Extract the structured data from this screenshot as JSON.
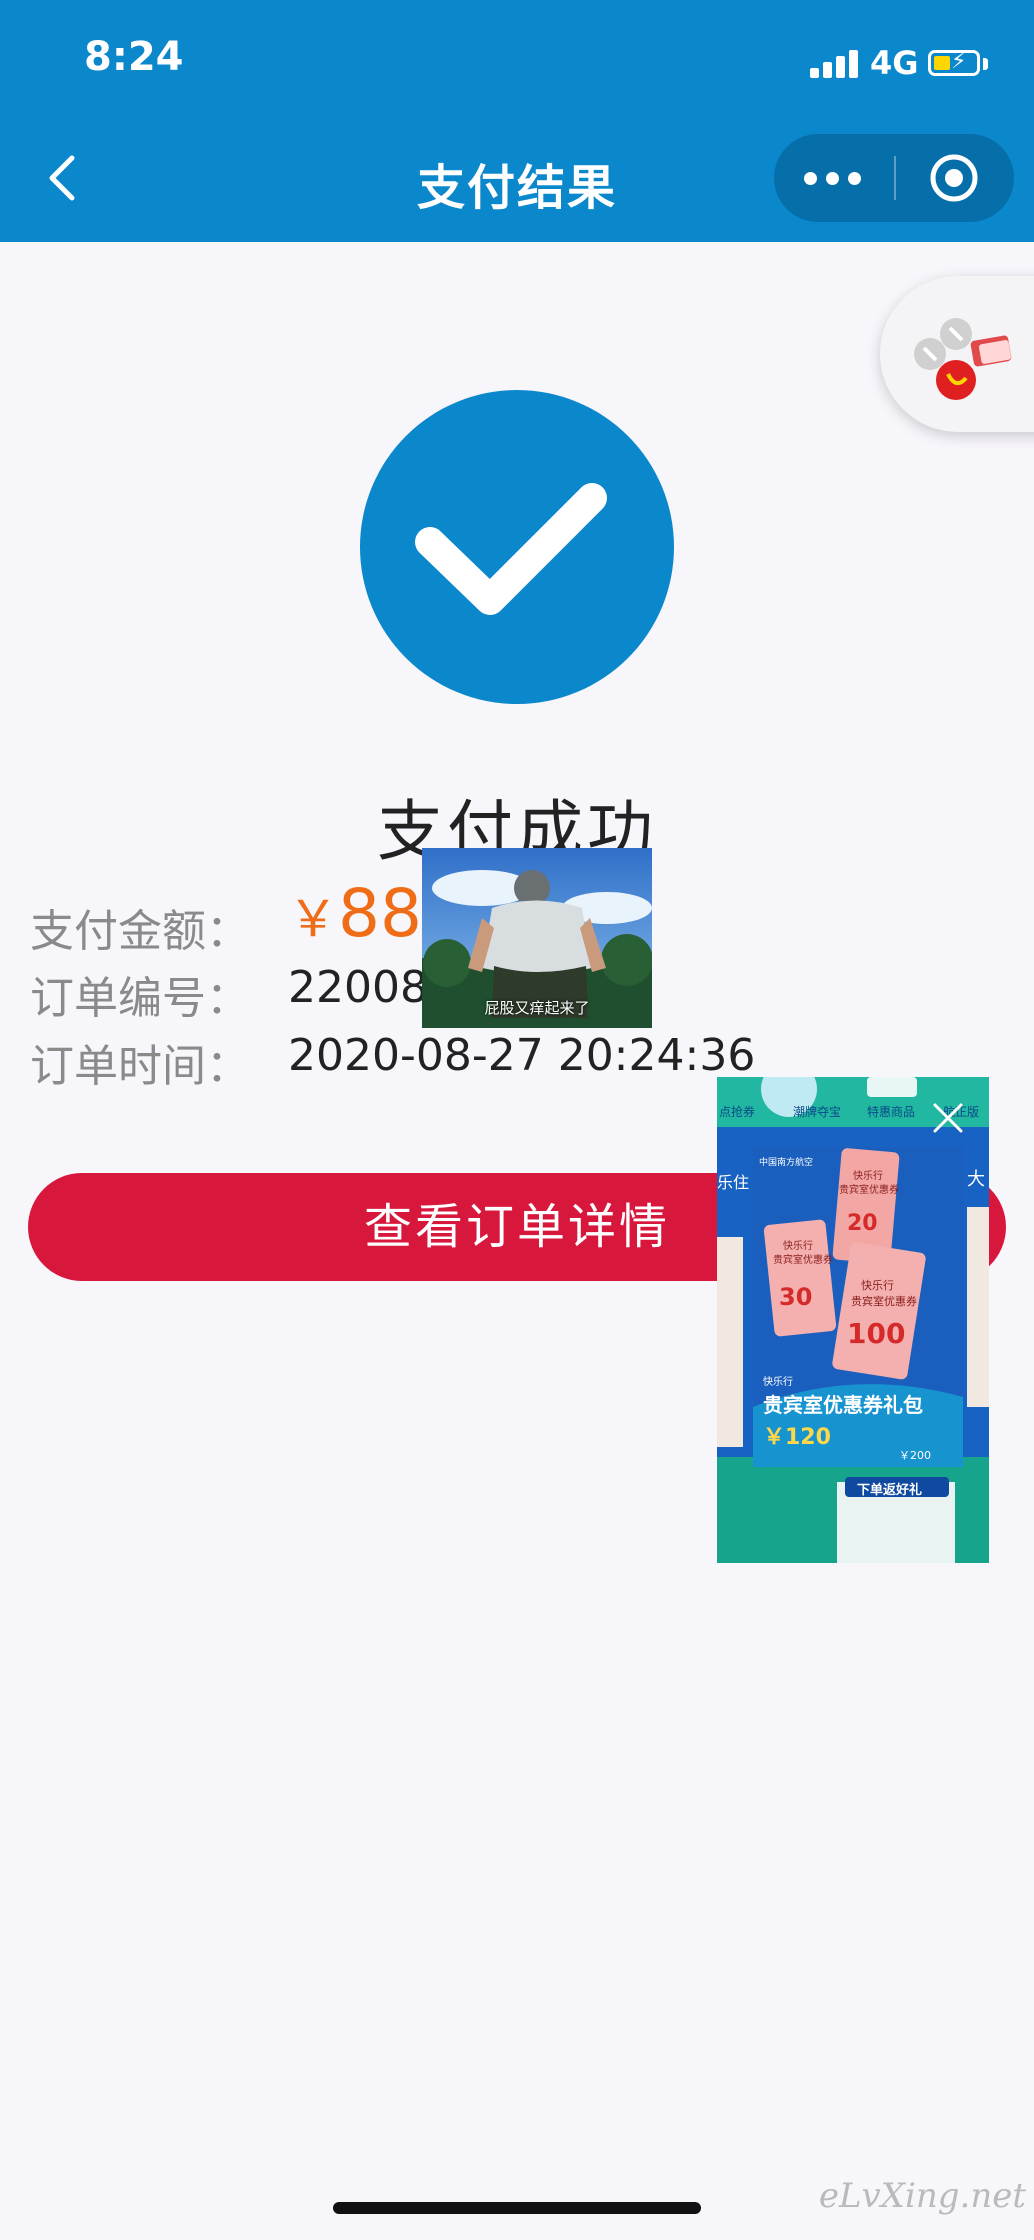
{
  "status_bar": {
    "time": "8:24",
    "network": "4G"
  },
  "nav": {
    "title": "支付结果"
  },
  "result": {
    "title": "支付成功"
  },
  "info": {
    "amount_label": "支付金额：",
    "amount_currency": "￥",
    "amount_value": "88",
    "order_no_label": "订单编号：",
    "order_no_value": "22008",
    "order_time_label": "订单时间：",
    "order_time_value": "2020-08-27 20:24:36"
  },
  "actions": {
    "detail_button": "查看订单详情"
  },
  "overlays": {
    "meme_caption": "屁股又痒起来了",
    "ad": {
      "top_labels": [
        "点抢券",
        "潮牌夺宝",
        "特惠商品",
        "航正版"
      ],
      "side_labels": [
        "乐住",
        "大"
      ],
      "airline": "中国南方航空",
      "coupon_header": "快乐行",
      "coupon_sub": "贵宾室优惠券",
      "coupon_values": [
        "20",
        "30",
        "100"
      ],
      "package_small": "快乐行",
      "package_title": "贵宾室优惠券礼包",
      "price": "￥120",
      "original_price": "￥200",
      "footer_title": "下单返好礼"
    }
  },
  "watermark": "eLvXing.net",
  "colors": {
    "primary_blue": "#0b87cc",
    "button_red": "#d8173d",
    "amount_orange": "#ef6d17"
  }
}
